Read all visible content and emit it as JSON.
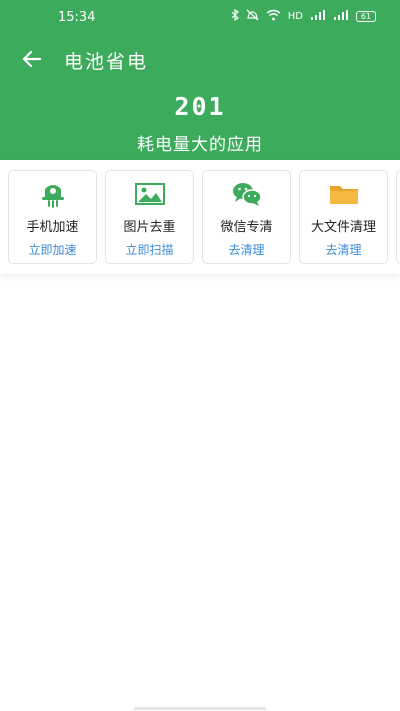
{
  "status_bar": {
    "time": "15:34",
    "hd": "HD",
    "battery": "61",
    "icons": [
      "bluetooth-icon",
      "mute-icon",
      "wifi-icon",
      "signal-icon",
      "signal-icon",
      "battery-icon"
    ]
  },
  "header": {
    "back_icon": "back-arrow-icon",
    "title": "电池省电",
    "count": "201",
    "subtitle": "耗电量大的应用"
  },
  "cards": [
    {
      "label": "手机加速",
      "action": "立即加速",
      "icon": "rocket-icon"
    },
    {
      "label": "图片去重",
      "action": "立即扫描",
      "icon": "image-icon"
    },
    {
      "label": "微信专清",
      "action": "去清理",
      "icon": "wechat-icon"
    },
    {
      "label": "大文件清理",
      "action": "去清理",
      "icon": "folder-icon"
    }
  ],
  "colors": {
    "primary": "#3dab5c",
    "action": "#3b8bd8",
    "folder": "#f5b840"
  }
}
